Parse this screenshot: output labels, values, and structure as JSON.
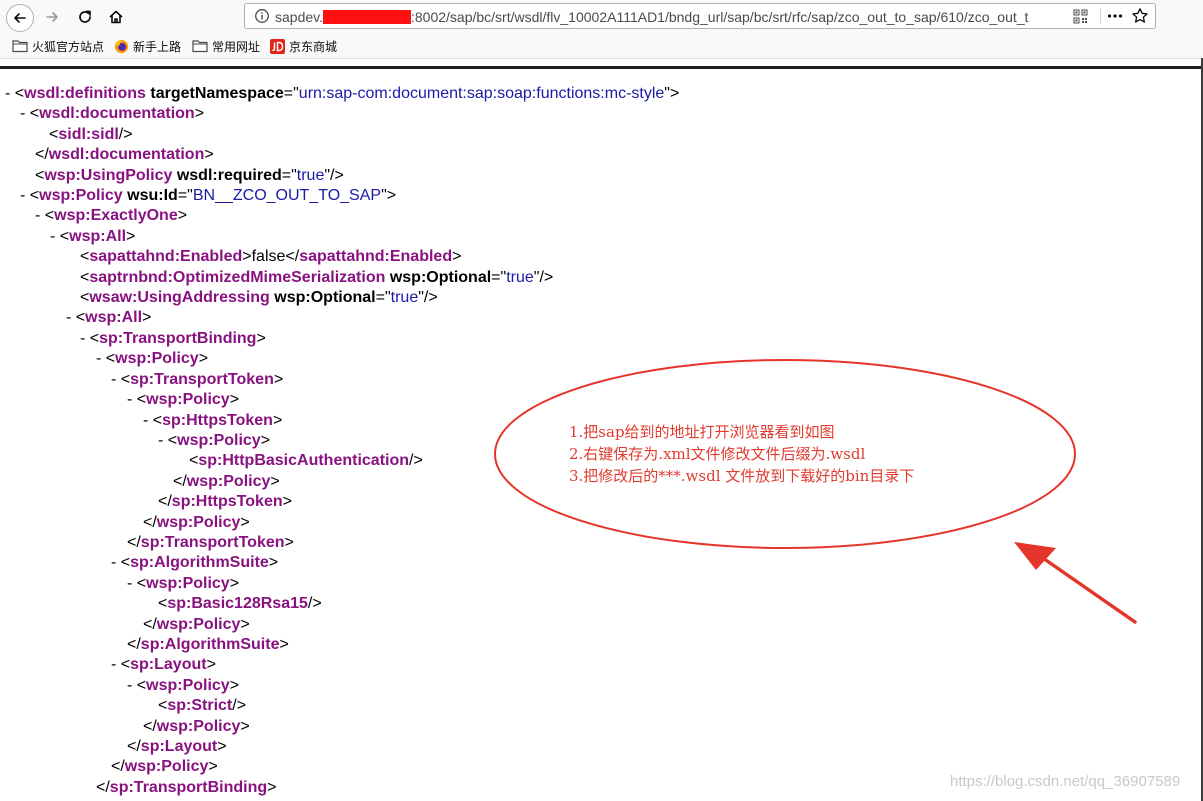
{
  "browser": {
    "url_prefix": "sapdev.",
    "url_suffix": ":8002/sap/bc/srt/wsdl/flv_10002A111AD1/bndg_url/sap/bc/srt/rfc/sap/zco_out_to_sap/610/zco_out_t",
    "bookmarks": [
      {
        "label": "火狐官方站点",
        "icon": "folder-icon"
      },
      {
        "label": "新手上路",
        "icon": "firefox-icon"
      },
      {
        "label": "常用网址",
        "icon": "folder-icon"
      },
      {
        "label": "京东商城",
        "icon": "jd-icon"
      }
    ]
  },
  "xml": {
    "toggle": "-",
    "lines": [
      [
        "- ",
        "<",
        "wsdl:definitions",
        " ",
        "targetNamespace",
        "=\"",
        "urn:sap-com:document:sap:soap:functions:mc-style",
        "\">"
      ],
      [
        "- ",
        "<",
        "wsdl:documentation",
        ">"
      ],
      [
        "<",
        "sidl:sidl",
        "/>"
      ],
      [
        "</",
        "wsdl:documentation",
        ">"
      ],
      [
        "<",
        "wsp:UsingPolicy",
        " ",
        "wsdl:required",
        "=\"",
        "true",
        "\"/>"
      ],
      [
        "- ",
        "<",
        "wsp:Policy",
        " ",
        "wsu:Id",
        "=\"",
        "BN__ZCO_OUT_TO_SAP",
        "\">"
      ],
      [
        "- ",
        "<",
        "wsp:ExactlyOne",
        ">"
      ],
      [
        "- ",
        "<",
        "wsp:All",
        ">"
      ],
      [
        "<",
        "sapattahnd:Enabled",
        ">",
        "false",
        "</",
        "sapattahnd:Enabled",
        ">"
      ],
      [
        "<",
        "saptrnbnd:OptimizedMimeSerialization",
        " ",
        "wsp:Optional",
        "=\"",
        "true",
        "\"/>"
      ],
      [
        "<",
        "wsaw:UsingAddressing",
        " ",
        "wsp:Optional",
        "=\"",
        "true",
        "\"/>"
      ],
      [
        "- ",
        "<",
        "wsp:All",
        ">"
      ],
      [
        "- ",
        "<",
        "sp:TransportBinding",
        ">"
      ],
      [
        "- ",
        "<",
        "wsp:Policy",
        ">"
      ],
      [
        "- ",
        "<",
        "sp:TransportToken",
        ">"
      ],
      [
        "- ",
        "<",
        "wsp:Policy",
        ">"
      ],
      [
        "- ",
        "<",
        "sp:HttpsToken",
        ">"
      ],
      [
        "- ",
        "<",
        "wsp:Policy",
        ">"
      ],
      [
        "<",
        "sp:HttpBasicAuthentication",
        "/>"
      ],
      [
        "</",
        "wsp:Policy",
        ">"
      ],
      [
        "</",
        "sp:HttpsToken",
        ">"
      ],
      [
        "</",
        "wsp:Policy",
        ">"
      ],
      [
        "</",
        "sp:TransportToken",
        ">"
      ],
      [
        "- ",
        "<",
        "sp:AlgorithmSuite",
        ">"
      ],
      [
        "- ",
        "<",
        "wsp:Policy",
        ">"
      ],
      [
        "<",
        "sp:Basic128Rsa15",
        "/>"
      ],
      [
        "</",
        "wsp:Policy",
        ">"
      ],
      [
        "</",
        "sp:AlgorithmSuite",
        ">"
      ],
      [
        "- ",
        "<",
        "sp:Layout",
        ">"
      ],
      [
        "- ",
        "<",
        "wsp:Policy",
        ">"
      ],
      [
        "<",
        "sp:Strict",
        "/>"
      ],
      [
        "</",
        "wsp:Policy",
        ">"
      ],
      [
        "</",
        "sp:Layout",
        ">"
      ],
      [
        "</",
        "wsp:Policy",
        ">"
      ],
      [
        "</",
        "sp:TransportBinding",
        ">"
      ]
    ]
  },
  "annotation": {
    "lines": [
      "1.把sap给到的地址打开浏览器看到如图",
      "2.右键保存为.xml文件修改文件后缀为.wsdl",
      "3.把修改后的***.wsdl 文件放到下载好的bin目录下"
    ],
    "color": "#e03b2e"
  },
  "watermark": "https://blog.csdn.net/qq_36907589"
}
